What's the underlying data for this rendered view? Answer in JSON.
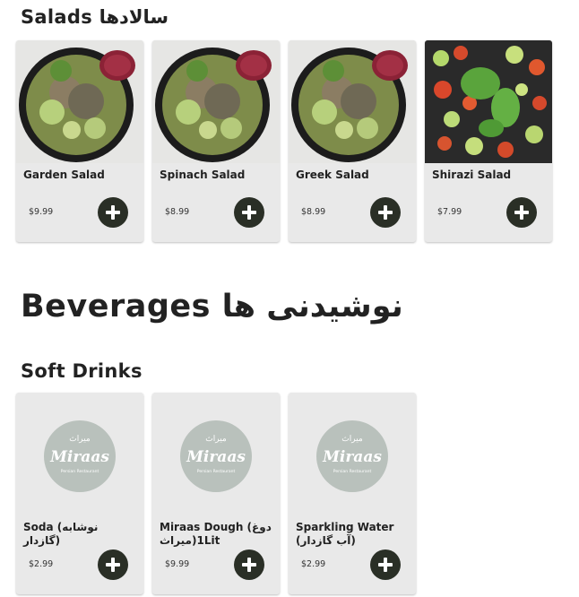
{
  "salads_section": {
    "title": "Salads سالادها",
    "items": [
      {
        "name": "Garden Salad",
        "price": "$9.99"
      },
      {
        "name": "Spinach Salad",
        "price": "$8.99"
      },
      {
        "name": "Greek Salad",
        "price": "$8.99"
      },
      {
        "name": "Shirazi Salad",
        "price": "$7.99"
      }
    ]
  },
  "beverages_section": {
    "title": "Beverages نوشیدنی ها"
  },
  "soft_drinks_section": {
    "title": "Soft Drinks",
    "logo": {
      "script": "Miraas",
      "subtitle": "Persian Restaurant",
      "persian": "میراث"
    },
    "items": [
      {
        "name": "Soda (نوشابه گازدار)",
        "price": "$2.99"
      },
      {
        "name": "Miraas Dough (دوغ میراث)1Lit",
        "price": "$9.99"
      },
      {
        "name": "Sparkling Water (آب گازدار)",
        "price": "$2.99"
      }
    ]
  },
  "colors": {
    "card_bg": "#e9e9e9",
    "button_bg": "#2a2f26",
    "button_icon": "#ffffff"
  },
  "icons": {
    "add": "plus-icon"
  }
}
